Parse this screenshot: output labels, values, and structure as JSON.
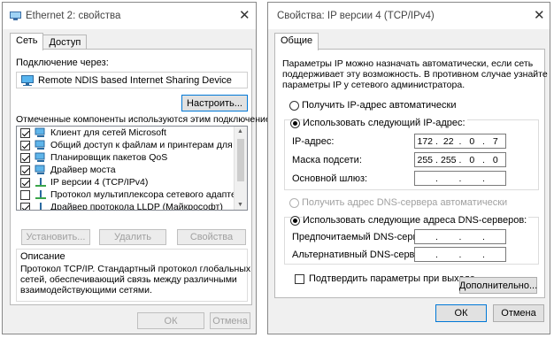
{
  "left": {
    "title": "Ethernet 2: свойства",
    "tabs": [
      "Сеть",
      "Доступ"
    ],
    "connect_via_label": "Подключение через:",
    "adapter_name": "Remote NDIS based Internet Sharing Device",
    "configure_button": "Настроить...",
    "components_label": "Отмеченные компоненты используются этим подключением:",
    "components": [
      {
        "label": "Клиент для сетей Microsoft",
        "checked": true,
        "icon": "network-client-icon"
      },
      {
        "label": "Общий доступ к файлам и принтерам для сетей Mi",
        "checked": true,
        "icon": "network-service-icon"
      },
      {
        "label": "Планировщик пакетов QoS",
        "checked": true,
        "icon": "network-service-icon"
      },
      {
        "label": "Драйвер моста",
        "checked": true,
        "icon": "network-service-icon"
      },
      {
        "label": "IP версии 4 (TCP/IPv4)",
        "checked": true,
        "icon": "protocol-icon"
      },
      {
        "label": "Протокол мультиплексора сетевого адаптера (Ма",
        "checked": false,
        "icon": "protocol-icon"
      },
      {
        "label": "Драйвер протокола LLDP (Майкрософт)",
        "checked": true,
        "icon": "protocol-icon"
      }
    ],
    "install_button": "Установить...",
    "remove_button": "Удалить",
    "properties_button": "Свойства",
    "description_title": "Описание",
    "description_text": [
      "Протокол TCP/IP. Стандартный протокол глобальных",
      "сетей, обеспечивающий связь между различными",
      "взаимодействующими сетями."
    ],
    "ok_button": "ОК",
    "cancel_button": "Отмена"
  },
  "right": {
    "title": "Свойства: IP версии 4 (TCP/IPv4)",
    "tab": "Общие",
    "intro": [
      "Параметры IP можно назначать автоматически, если сеть",
      "поддерживает эту возможность. В противном случае узнайте",
      "параметры IP у сетевого администратора."
    ],
    "auto_ip_label": "Получить IP-адрес автоматически",
    "manual_ip_label": "Использовать следующий IP-адрес:",
    "ip_label": "IP-адрес:",
    "ip_value": [
      "172",
      "22",
      "0",
      "7"
    ],
    "mask_label": "Маска подсети:",
    "mask_value": [
      "255",
      "255",
      "0",
      "0"
    ],
    "gateway_label": "Основной шлюз:",
    "auto_dns_label": "Получить адрес DNS-сервера автоматически",
    "manual_dns_label": "Использовать следующие адреса DNS-серверов:",
    "pref_dns_label": "Предпочитаемый DNS-сервер:",
    "alt_dns_label": "Альтернативный DNS-сервер:",
    "validate_label": "Подтвердить параметры при выходе",
    "advanced_button": "Дополнительно...",
    "ok_button": "ОК",
    "cancel_button": "Отмена"
  }
}
